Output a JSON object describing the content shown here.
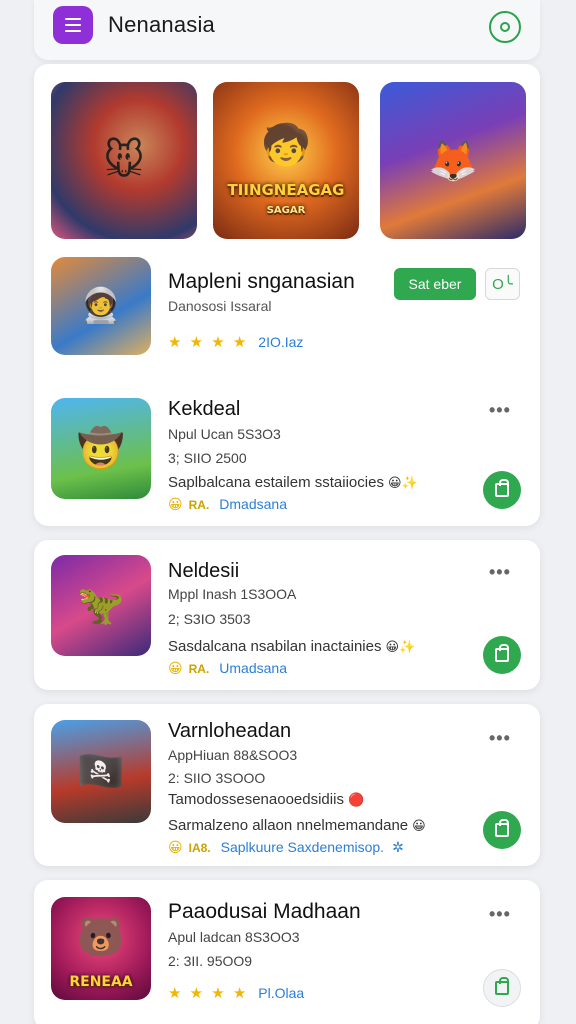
{
  "header": {
    "title": "Nenanasia",
    "menu_icon": "menu-icon",
    "search_icon": "search-icon",
    "accent": "#8e2fd8",
    "green": "#2fa84f"
  },
  "featured": {
    "banner_text_1": "TIINGNEAGAG",
    "banner_text_2": "SAGAR"
  },
  "highlight": {
    "title": "Mapleni snganasian",
    "subtitle": "Danososi Issaral",
    "stars_text": "★ ★ ★ ★",
    "rating": "2IO.Iaz",
    "select_label": "Sat eber",
    "share_label": "O╰"
  },
  "items": [
    {
      "title": "Kekdeal",
      "line1": "Npul Ucan 5S3O3",
      "line2": "3; SIIO 2500",
      "desc": "Saplbalcana estailem sstaiiocies",
      "rating_word": "RA.",
      "link": "Dmadsana"
    },
    {
      "title": "Neldesii",
      "line1": "Mppl Inash 1S3OOA",
      "line2": "2; S3IO 3503",
      "desc": "Sasdalcana nsabilan inactainies",
      "rating_word": "RA.",
      "link": "Umadsana"
    },
    {
      "title": "Varnloheadan",
      "line1": "AppHiuan 88&SOO3",
      "line2": "2: SIIO 3SOOO",
      "line3": "Tamodossesenaooedsidiis",
      "desc": "Sarmalzeno allaon nnelmemandane",
      "rating_word": "IA8.",
      "link": "Saplkuure Saxdenemisop."
    },
    {
      "title": "Paaodusai Madhaan",
      "line1": "Apul ladcan 8S3OO3",
      "line2": "2: 3II. 95OO9",
      "stars_text": "★ ★ ★ ★",
      "rating": "Pl.Olaa",
      "banner_text": "RENEAA"
    }
  ]
}
